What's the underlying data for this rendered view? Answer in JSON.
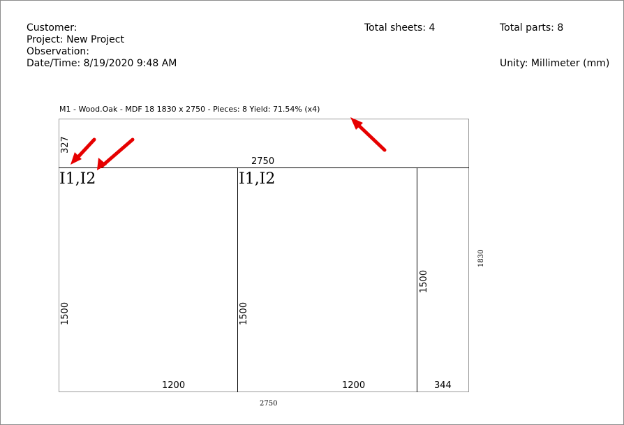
{
  "header": {
    "customer": "Customer:",
    "project": "Project: New Project",
    "observation": "Observation:",
    "datetime": "Date/Time: 8/19/2020 9:48 AM",
    "total_sheets": "Total sheets: 4",
    "total_parts": "Total parts: 8",
    "unity": "Unity: Millimeter (mm)"
  },
  "sheet": {
    "title": "M1 - Wood.Oak - MDF 18 1830 x 2750 - Pieces: 8 Yield: 71.54% (x4)",
    "dim_top_strip": "327",
    "dim_strip_length": "2750",
    "part_left_label": "I1,I2",
    "part_mid_label": "I1,I2",
    "dim_left_height": "1500",
    "dim_mid_height": "1500",
    "dim_right_height": "1500",
    "dim_left_width": "1200",
    "dim_mid_width": "1200",
    "dim_right_width": "344",
    "sheet_height": "1830",
    "sheet_width": "2750"
  },
  "colors": {
    "annotation_arrow": "#e60000"
  }
}
